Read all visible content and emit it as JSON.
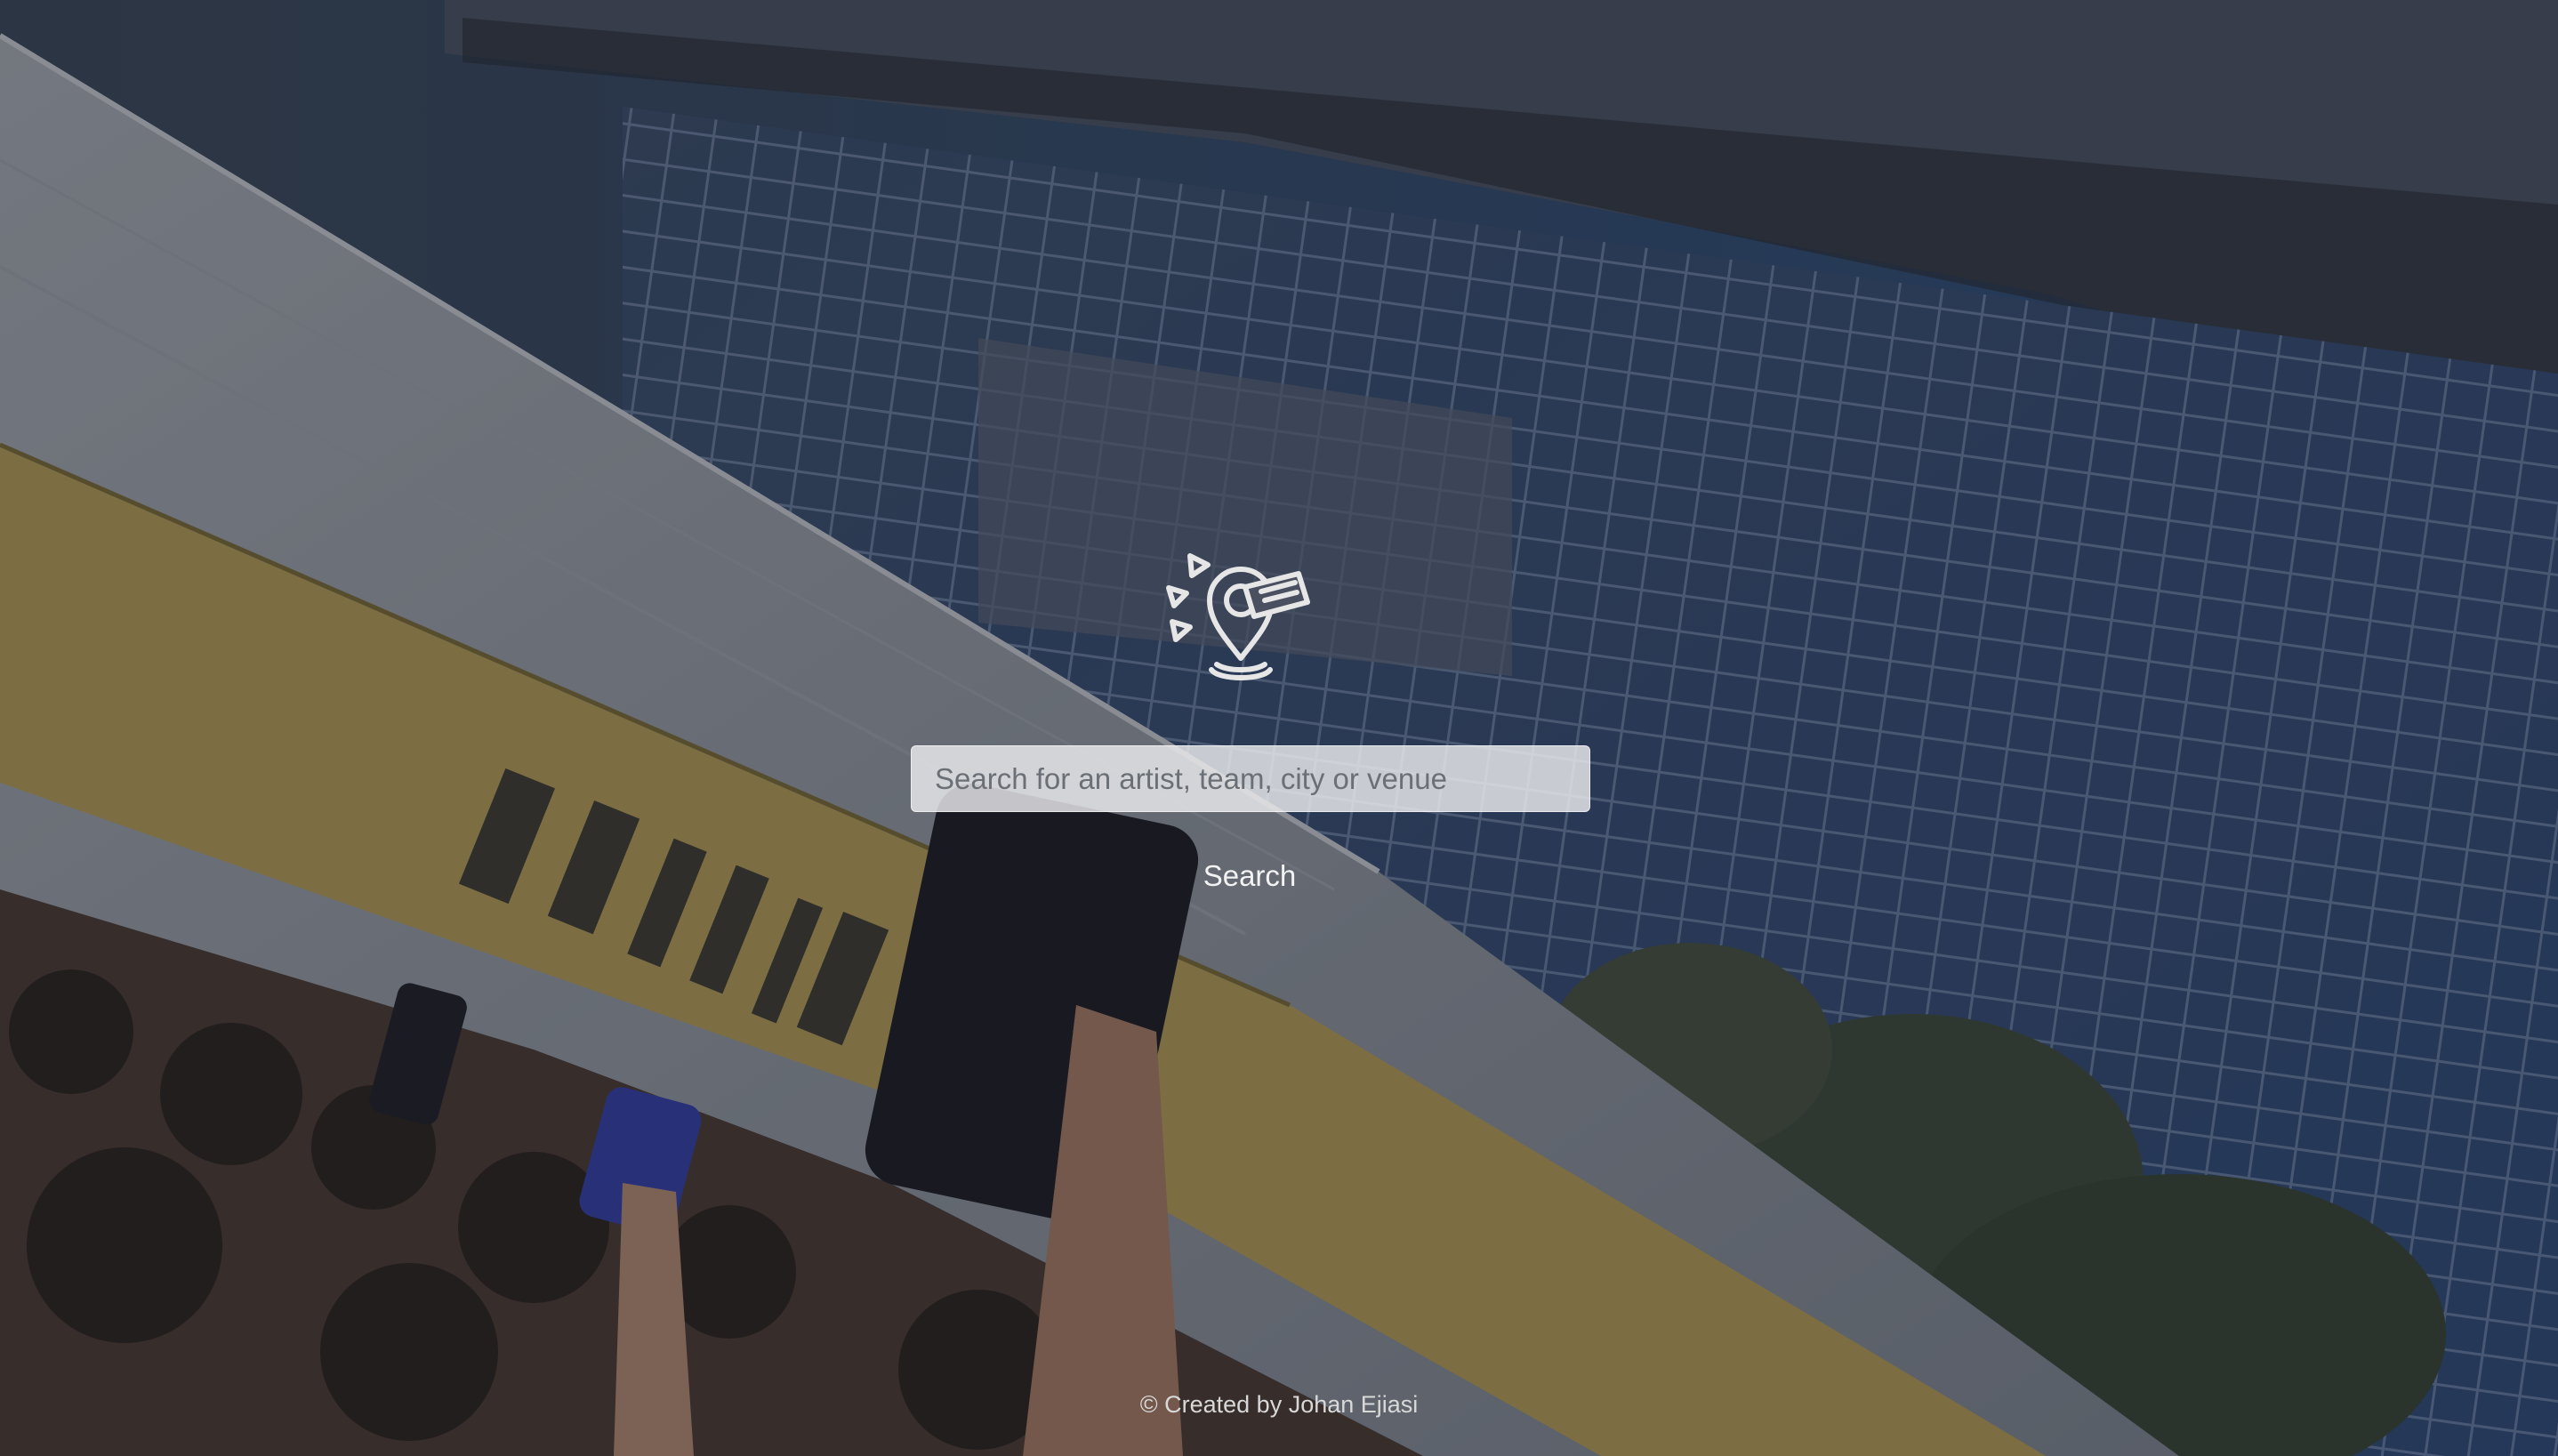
{
  "search": {
    "placeholder": "Search for an artist, team, city or venue",
    "value": "",
    "button_label": "Search"
  },
  "footer": {
    "credit": "© Created by Johan Ejiasi"
  },
  "logo": {
    "icon": "ticket-location-pin-icon"
  },
  "colors": {
    "overlay": "#141820",
    "input_bg": "#ebecee",
    "text_light": "#f2f2f2"
  }
}
